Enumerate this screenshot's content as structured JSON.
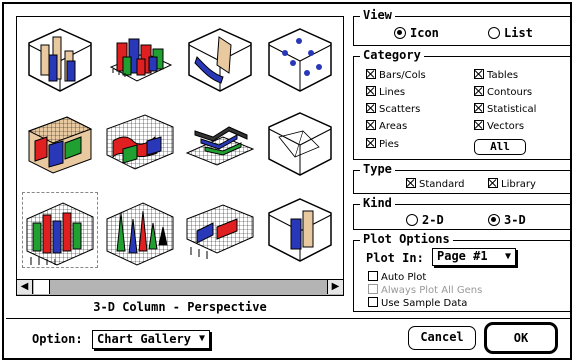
{
  "gallery": {
    "selected_caption": "3-D Column - Perspective",
    "thumbnails": [
      {
        "name": "3d-column-chart-icon"
      },
      {
        "name": "3d-multi-column-chart-icon"
      },
      {
        "name": "3d-ribbon-chart-icon"
      },
      {
        "name": "3d-scatter-chart-icon"
      },
      {
        "name": "3d-area-block-chart-icon"
      },
      {
        "name": "3d-grid-surface-chart-icon"
      },
      {
        "name": "3d-ribbon-line-chart-icon"
      },
      {
        "name": "3d-wireframe-box-icon"
      },
      {
        "name": "3d-column-perspective-icon"
      },
      {
        "name": "3d-spike-surface-chart-icon"
      },
      {
        "name": "3d-mesh-surface-chart-icon"
      },
      {
        "name": "3d-single-column-icon"
      }
    ],
    "scroll_left": "◀",
    "scroll_right": "▶"
  },
  "option": {
    "label": "Option:",
    "value": "Chart Gallery",
    "arrow": "▼"
  },
  "view": {
    "title": "View",
    "options": [
      "Icon",
      "List"
    ],
    "selected": "Icon"
  },
  "category": {
    "title": "Category",
    "items": [
      {
        "label": "Bars/Cols",
        "checked": true
      },
      {
        "label": "Tables",
        "checked": true
      },
      {
        "label": "Lines",
        "checked": true
      },
      {
        "label": "Contours",
        "checked": true
      },
      {
        "label": "Scatters",
        "checked": true
      },
      {
        "label": "Statistical",
        "checked": true
      },
      {
        "label": "Areas",
        "checked": true
      },
      {
        "label": "Vectors",
        "checked": true
      },
      {
        "label": "Pies",
        "checked": true
      }
    ],
    "all_button": "All"
  },
  "type": {
    "title": "Type",
    "items": [
      {
        "label": "Standard",
        "checked": true
      },
      {
        "label": "Library",
        "checked": true
      }
    ]
  },
  "kind": {
    "title": "Kind",
    "options": [
      "2-D",
      "3-D"
    ],
    "selected": "3-D"
  },
  "plot_options": {
    "title": "Plot Options",
    "plot_in_label": "Plot In:",
    "plot_in_value": "Page #1",
    "arrow": "▼",
    "checkboxes": [
      {
        "label": "Auto Plot",
        "checked": false,
        "enabled": true
      },
      {
        "label": "Always Plot All Gens",
        "checked": false,
        "enabled": false
      },
      {
        "label": "Use Sample Data",
        "checked": false,
        "enabled": true
      }
    ]
  },
  "buttons": {
    "cancel": "Cancel",
    "ok": "OK"
  },
  "colors": {
    "tan": "#e8c9a0",
    "blue": "#2838b8",
    "red": "#e02020",
    "green": "#20a030",
    "grid": "#1a1a1a"
  }
}
